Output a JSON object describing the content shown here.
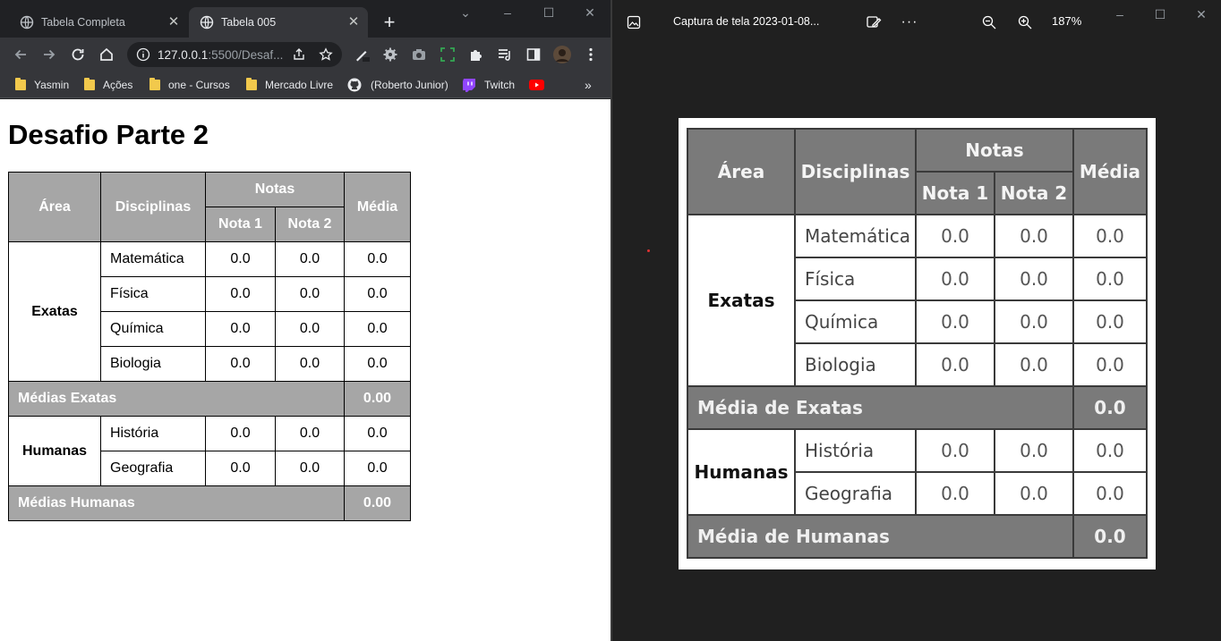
{
  "browser": {
    "tabs": [
      {
        "title": "Tabela Completa",
        "active": false
      },
      {
        "title": "Tabela 005",
        "active": true
      }
    ],
    "new_tab_label": "+",
    "url_host": "127.0.0.1",
    "url_rest": ":5500/Desaf...",
    "bookmarks": [
      "Yasmin",
      "Ações",
      "one - Cursos",
      "Mercado Livre",
      "(Roberto Junior)",
      "Twitch"
    ],
    "more_bookmarks": "»",
    "colors": {
      "chrome_bg": "#202124",
      "toolbar_bg": "#35363a",
      "folder": "#f2c94c",
      "twitch": "#9146ff",
      "youtube": "#ff0000"
    }
  },
  "page": {
    "title": "Desafio Parte 2",
    "table": {
      "headers": {
        "area": "Área",
        "disciplinas": "Disciplinas",
        "notas": "Notas",
        "nota1": "Nota 1",
        "nota2": "Nota 2",
        "media": "Média"
      },
      "exatas": {
        "area": "Exatas",
        "rows": [
          {
            "disc": "Matemática",
            "n1": "0.0",
            "n2": "0.0",
            "media": "0.0"
          },
          {
            "disc": "Física",
            "n1": "0.0",
            "n2": "0.0",
            "media": "0.0"
          },
          {
            "disc": "Química",
            "n1": "0.0",
            "n2": "0.0",
            "media": "0.0"
          },
          {
            "disc": "Biologia",
            "n1": "0.0",
            "n2": "0.0",
            "media": "0.0"
          }
        ],
        "avg_label": "Médias Exatas",
        "avg_value": "0.00"
      },
      "humanas": {
        "area": "Humanas",
        "rows": [
          {
            "disc": "História",
            "n1": "0.0",
            "n2": "0.0",
            "media": "0.0"
          },
          {
            "disc": "Geografia",
            "n1": "0.0",
            "n2": "0.0",
            "media": "0.0"
          }
        ],
        "avg_label": "Médias Humanas",
        "avg_value": "0.00"
      },
      "header_bg": "#a6a6a6"
    }
  },
  "photos": {
    "title": "Captura de tela 2023-01-08...",
    "zoom": "187%",
    "more_label": "···",
    "table": {
      "headers": {
        "area": "Área",
        "disciplinas": "Disciplinas",
        "notas": "Notas",
        "nota1": "Nota 1",
        "nota2": "Nota 2",
        "media": "Média"
      },
      "exatas": {
        "area": "Exatas",
        "rows": [
          {
            "disc": "Matemática",
            "n1": "0.0",
            "n2": "0.0",
            "media": "0.0"
          },
          {
            "disc": "Física",
            "n1": "0.0",
            "n2": "0.0",
            "media": "0.0"
          },
          {
            "disc": "Química",
            "n1": "0.0",
            "n2": "0.0",
            "media": "0.0"
          },
          {
            "disc": "Biologia",
            "n1": "0.0",
            "n2": "0.0",
            "media": "0.0"
          }
        ],
        "avg_label": "Média de Exatas",
        "avg_value": "0.0"
      },
      "humanas": {
        "area": "Humanas",
        "rows": [
          {
            "disc": "História",
            "n1": "0.0",
            "n2": "0.0",
            "media": "0.0"
          },
          {
            "disc": "Geografia",
            "n1": "0.0",
            "n2": "0.0",
            "media": "0.0"
          }
        ],
        "avg_label": "Média de Humanas",
        "avg_value": "0.0"
      }
    }
  }
}
